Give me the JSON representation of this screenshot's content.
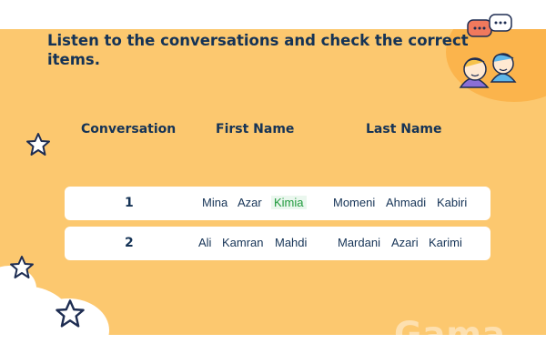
{
  "instruction": "Listen to the conversations and check the correct items.",
  "headers": {
    "conversation": "Conversation",
    "first_name": "First Name",
    "last_name": "Last Name"
  },
  "rows": [
    {
      "number": "1",
      "first_names": [
        "Mina",
        "Azar",
        "Kimia"
      ],
      "last_names": [
        "Momeni",
        "Ahmadi",
        "Kabiri"
      ],
      "selected": "Kimia"
    },
    {
      "number": "2",
      "first_names": [
        "Ali",
        "Kamran",
        "Mahdi"
      ],
      "last_names": [
        "Mardani",
        "Azari",
        "Karimi"
      ],
      "selected": null
    }
  ],
  "watermark": "Gama",
  "colors": {
    "background": "#fcc86f",
    "accent_blob": "#fbb44c",
    "text": "#153356",
    "selected": "#1f9a3c"
  },
  "icons": [
    "chat-people-icon",
    "star-icon"
  ]
}
